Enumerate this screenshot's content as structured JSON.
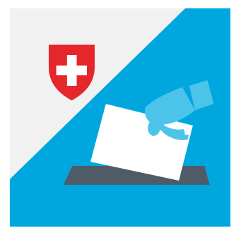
{
  "app_icon": {
    "subject": "voting app icon",
    "emblem": "swiss-coat-of-arms",
    "illustration": "hand-casting-ballot",
    "colors": {
      "background_light": "#f1f1f1",
      "background_blue": "#00a7df",
      "hand": "#4cc4ea",
      "ballot": "#ffffff",
      "ballot_box_slot": "#4f5b66",
      "shield_red": "#e5272b",
      "cross_white": "#ffffff"
    }
  }
}
